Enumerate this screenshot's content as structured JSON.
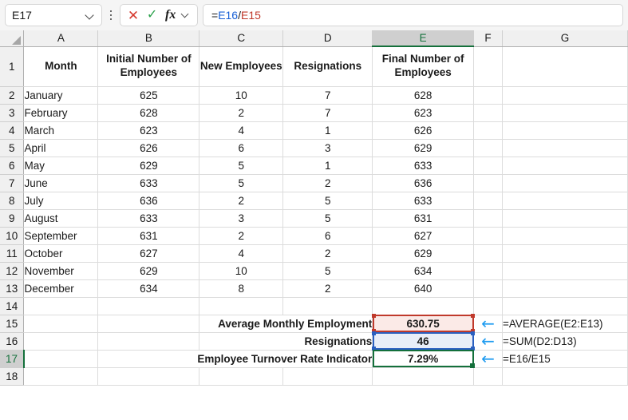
{
  "formula_bar": {
    "name_box_value": "E17",
    "name_box_chevron_icon": "chevron-down-icon",
    "kebab_icon": "more-options-icon",
    "cancel_icon": "✕",
    "confirm_icon": "✓",
    "fx_icon": "fx",
    "fx_chevron_icon": "chevron-down-icon",
    "formula_parts": {
      "equals": "=",
      "ref1": "E16",
      "operator": "/",
      "ref2": "E15"
    },
    "formula_full": "=E16/E15"
  },
  "grid": {
    "column_headers": [
      "A",
      "B",
      "C",
      "D",
      "E",
      "F",
      "G"
    ],
    "selected_column": "E",
    "selected_row": "17",
    "selected_cell": "E17",
    "row_numbers": [
      "1",
      "2",
      "3",
      "4",
      "5",
      "6",
      "7",
      "8",
      "9",
      "10",
      "11",
      "12",
      "13",
      "14",
      "15",
      "16",
      "17",
      "18"
    ],
    "headers": {
      "a": "Month",
      "b": "Initial Number of Employees",
      "c": "New Employees",
      "d": "Resignations",
      "e": "Final Number of Employees"
    },
    "rows": [
      {
        "row": "2",
        "month": "January",
        "initial": "625",
        "new": "10",
        "resign": "7",
        "final": "628"
      },
      {
        "row": "3",
        "month": "February",
        "initial": "628",
        "new": "2",
        "resign": "7",
        "final": "623"
      },
      {
        "row": "4",
        "month": "March",
        "initial": "623",
        "new": "4",
        "resign": "1",
        "final": "626"
      },
      {
        "row": "5",
        "month": "April",
        "initial": "626",
        "new": "6",
        "resign": "3",
        "final": "629"
      },
      {
        "row": "6",
        "month": "May",
        "initial": "629",
        "new": "5",
        "resign": "1",
        "final": "633"
      },
      {
        "row": "7",
        "month": "June",
        "initial": "633",
        "new": "5",
        "resign": "2",
        "final": "636"
      },
      {
        "row": "8",
        "month": "July",
        "initial": "636",
        "new": "2",
        "resign": "5",
        "final": "633"
      },
      {
        "row": "9",
        "month": "August",
        "initial": "633",
        "new": "3",
        "resign": "5",
        "final": "631"
      },
      {
        "row": "10",
        "month": "September",
        "initial": "631",
        "new": "2",
        "resign": "6",
        "final": "627"
      },
      {
        "row": "11",
        "month": "October",
        "initial": "627",
        "new": "4",
        "resign": "2",
        "final": "629"
      },
      {
        "row": "12",
        "month": "November",
        "initial": "629",
        "new": "10",
        "resign": "5",
        "final": "634"
      },
      {
        "row": "13",
        "month": "December",
        "initial": "634",
        "new": "8",
        "resign": "2",
        "final": "640"
      }
    ],
    "summary": [
      {
        "row": "15",
        "label": "Average Monthly Employment",
        "value": "630.75",
        "annotation": "=AVERAGE(E2:E13)",
        "arrow_icon": "←",
        "border_color": "#c0392b",
        "fill_color": "#fbeae7"
      },
      {
        "row": "16",
        "label": "Resignations",
        "value": "46",
        "annotation": "=SUM(D2:D13)",
        "arrow_icon": "←",
        "border_color": "#2a5fc0",
        "fill_color": "#e9eef8"
      },
      {
        "row": "17",
        "label": "Employee Turnover Rate Indicator",
        "value": "7.29%",
        "annotation": "=E16/E15",
        "arrow_icon": "←",
        "border_color": "#14703b",
        "fill_color": "#ffffff"
      }
    ]
  },
  "colors": {
    "selection_green": "#14703b",
    "precedent_red": "#c0392b",
    "precedent_blue": "#2a5fc0",
    "arrow_blue": "#1e9bf0",
    "header_gray": "#f0f0f0"
  }
}
